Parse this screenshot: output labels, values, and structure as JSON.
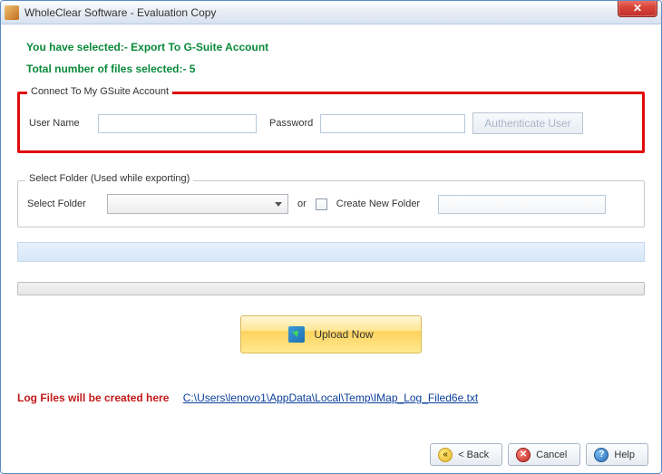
{
  "window": {
    "title": "WholeClear Software - Evaluation Copy"
  },
  "info": {
    "selected_line": "You have selected:- Export To G-Suite Account",
    "file_count_line": "Total number of files selected:- 5"
  },
  "connect_group": {
    "title": "Connect To My GSuite Account",
    "user_label": "User Name",
    "user_value": "",
    "pass_label": "Password",
    "pass_value": "",
    "auth_label": "Authenticate User"
  },
  "folder_group": {
    "title": "Select Folder (Used while exporting)",
    "select_label": "Select Folder",
    "or_label": "or",
    "create_label": "Create New Folder",
    "new_folder_value": ""
  },
  "upload": {
    "label": "Upload Now"
  },
  "log": {
    "label": "Log Files will be created here",
    "path": "C:\\Users\\lenovo1\\AppData\\Local\\Temp\\IMap_Log_Filed6e.txt"
  },
  "footer": {
    "back": "< Back",
    "cancel": "Cancel",
    "help": "Help"
  }
}
